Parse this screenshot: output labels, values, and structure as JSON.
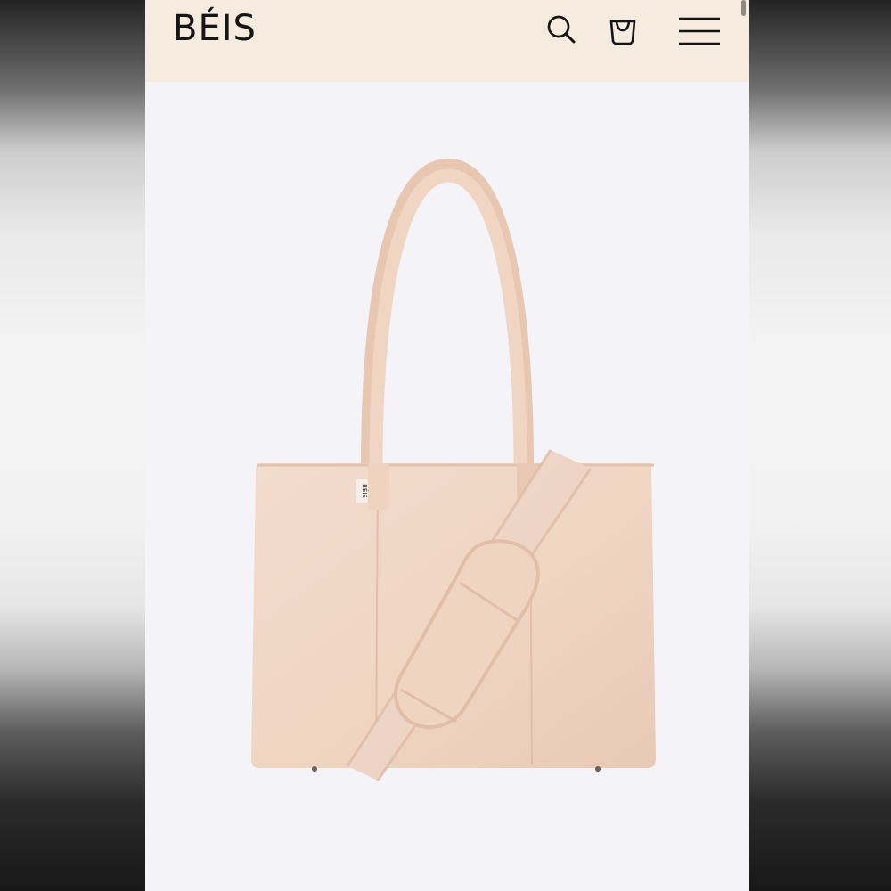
{
  "header": {
    "logo_text": "BÉIS",
    "background": "#f6ebdf",
    "icons": {
      "search": "search-icon",
      "bag": "shopping-bag-icon",
      "menu": "hamburger-menu-icon"
    }
  },
  "product": {
    "image_subject": "tote-bag-image",
    "tag_text": "BÉIS",
    "colors": {
      "bag": "#efd7c5",
      "strap": "#eed8c8",
      "background": "#f4f3f7"
    }
  }
}
